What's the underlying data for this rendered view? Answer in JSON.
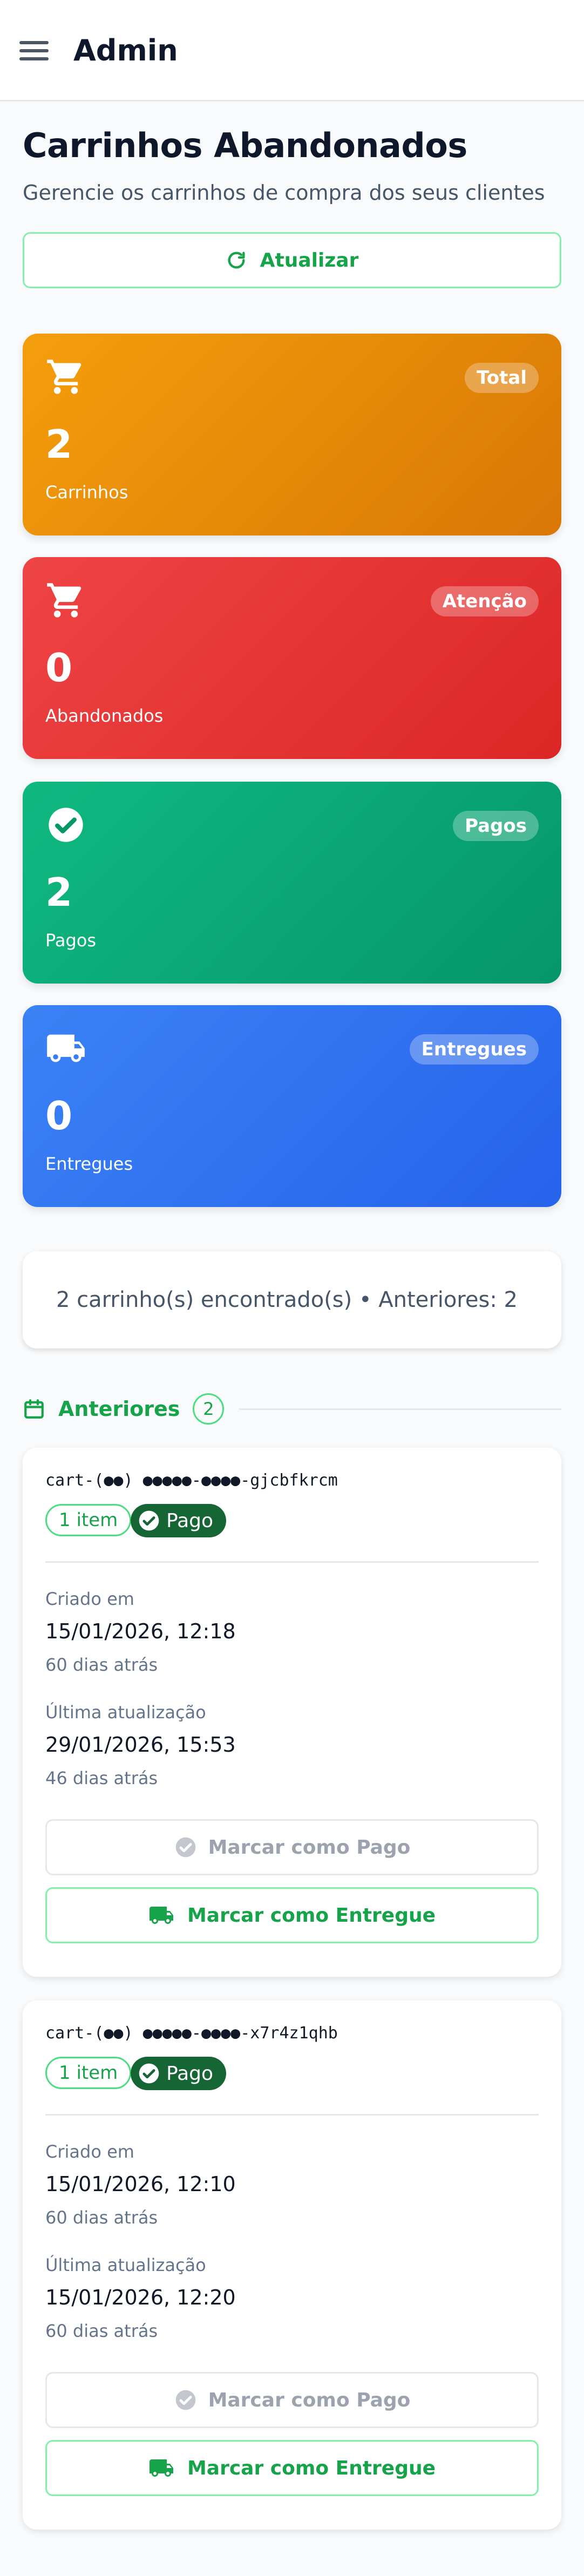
{
  "header": {
    "title": "Admin",
    "menu_icon": "hamburger-menu-icon"
  },
  "page": {
    "title": "Carrinhos Abandonados",
    "subtitle": "Gerencie os carrinhos de compra dos seus clientes",
    "refresh_label": "Atualizar"
  },
  "stats": {
    "total": {
      "badge": "Total",
      "value": "2",
      "label": "Carrinhos",
      "icon": "cart-icon",
      "color": "#f59e0b"
    },
    "abandoned": {
      "badge": "Atenção",
      "value": "0",
      "label": "Abandonados",
      "icon": "cart-icon",
      "color": "#ef4444"
    },
    "paid": {
      "badge": "Pagos",
      "value": "2",
      "label": "Pagos",
      "icon": "check-circle-icon",
      "color": "#10b981"
    },
    "delivered": {
      "badge": "Entregues",
      "value": "0",
      "label": "Entregues",
      "icon": "truck-icon",
      "color": "#3b82f6"
    }
  },
  "summary": {
    "text": "2 carrinho(s) encontrado(s) • Anteriores: 2"
  },
  "section": {
    "title": "Anteriores",
    "count": "2",
    "icon": "calendar-icon"
  },
  "carts": [
    {
      "id": "cart-(●●) ●●●●●-●●●●-gjcbfkrcm",
      "items": "1 item",
      "status": "Pago",
      "created_label": "Criado em",
      "created_value": "15/01/2026, 12:18",
      "created_rel": "60 dias atrás",
      "updated_label": "Última atualização",
      "updated_value": "29/01/2026, 15:53",
      "updated_rel": "46 dias atrás",
      "mark_paid_label": "Marcar como Pago",
      "mark_delivered_label": "Marcar como Entregue"
    },
    {
      "id": "cart-(●●) ●●●●●-●●●●-x7r4z1qhb",
      "items": "1 item",
      "status": "Pago",
      "created_label": "Criado em",
      "created_value": "15/01/2026, 12:10",
      "created_rel": "60 dias atrás",
      "updated_label": "Última atualização",
      "updated_value": "15/01/2026, 12:20",
      "updated_rel": "60 dias atrás",
      "mark_paid_label": "Marcar como Pago",
      "mark_delivered_label": "Marcar como Entregue"
    }
  ],
  "colors": {
    "accent": "#16a34a",
    "status_paid": "#166534"
  }
}
